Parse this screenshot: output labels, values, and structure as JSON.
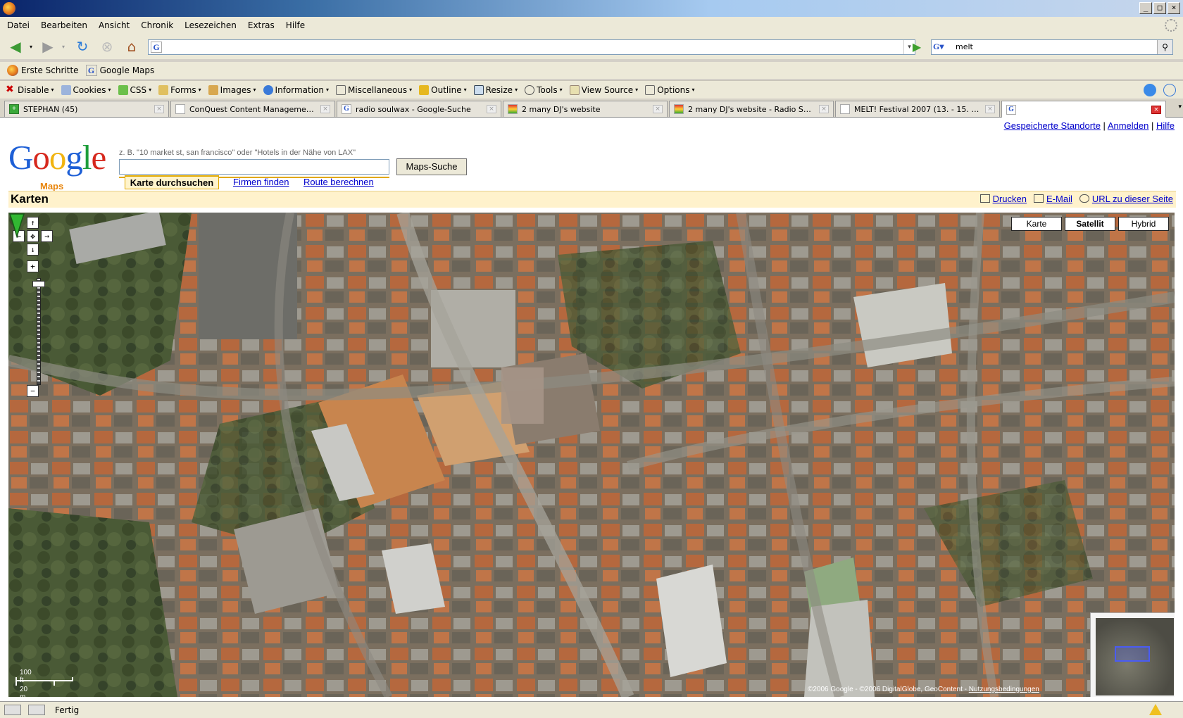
{
  "window": {
    "title": ""
  },
  "menu": [
    "Datei",
    "Bearbeiten",
    "Ansicht",
    "Chronik",
    "Lesezeichen",
    "Extras",
    "Hilfe"
  ],
  "nav": {
    "url_value": "",
    "search_value": "melt"
  },
  "bookmarks": [
    {
      "label": "Erste Schritte",
      "icon": "firefox-icon"
    },
    {
      "label": "Google Maps",
      "icon": "google-icon"
    }
  ],
  "devtools": [
    "Disable",
    "Cookies",
    "CSS",
    "Forms",
    "Images",
    "Information",
    "Miscellaneous",
    "Outline",
    "Resize",
    "Tools",
    "View Source",
    "Options"
  ],
  "tabs": [
    {
      "label": "STEPHAN (45)"
    },
    {
      "label": "ConQuest Content Management S..."
    },
    {
      "label": "radio soulwax - Google-Suche"
    },
    {
      "label": "2 many DJ's website"
    },
    {
      "label": "2 many DJ's website - Radio Soulw..."
    },
    {
      "label": "MELT! Festival 2007 (13. - 15. Juli ..."
    },
    {
      "label": ""
    }
  ],
  "page": {
    "top_links": [
      "Gespeicherte Standorte",
      "Anmelden",
      "Hilfe"
    ],
    "logo_maps": "Maps",
    "hint": "z. B. \"10 market st, san francisco\" oder \"Hotels in der Nähe von LAX\"",
    "search_value": "",
    "search_button": "Maps-Suche",
    "search_tabs": [
      "Karte durchsuchen",
      "Firmen finden",
      "Route berechnen"
    ],
    "section_title": "Karten",
    "actions": [
      "Drucken",
      "E-Mail",
      "URL zu dieser Seite"
    ],
    "map_types": [
      "Karte",
      "Satellit",
      "Hybrid"
    ],
    "selected_map_type": "Satellit",
    "scale_ft": "100 ft",
    "scale_m": "20 m",
    "copyright_prefix": "©2006 Google - ",
    "copyright_imagery": "©2006 DigitalGlobe, GeoContent - ",
    "terms_link": "Nutzungsbedingungen"
  },
  "status": {
    "text": "Fertig"
  },
  "colors": {
    "link": "#0000cc",
    "accent": "#e0a800",
    "bar_bg": "#fff2cc"
  }
}
